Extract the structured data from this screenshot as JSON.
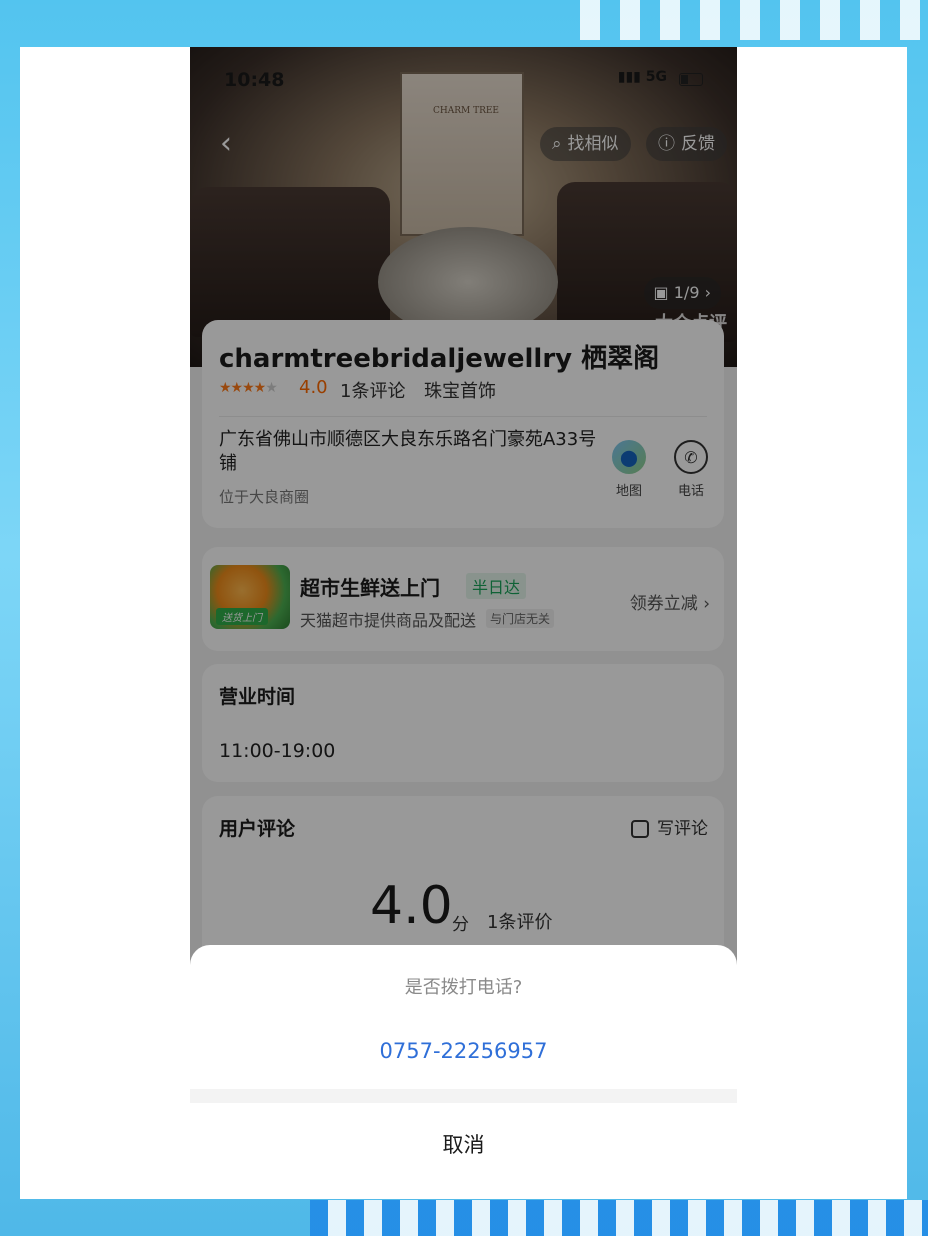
{
  "status_bar": {
    "time": "10:48",
    "network": "5G"
  },
  "hero": {
    "back_icon": "chevron-left-icon",
    "find_similar": "找相似",
    "feedback": "反馈",
    "photo_counter": "1/9",
    "store_sign": "CHARM TREE"
  },
  "store": {
    "name": "charmtreebridaljewellry 栖翠阁",
    "stars": 4,
    "rating": "4.0",
    "review_count": "1条评论",
    "category": "珠宝首饰",
    "address": "广东省佛山市顺德区大良东乐路名门豪苑A33号铺",
    "area": "位于大良商圈",
    "map_label": "地图",
    "phone_label": "电话"
  },
  "promo": {
    "image_tag": "送货上门",
    "title": "超市生鲜送上门",
    "badge": "半日达",
    "subtitle": "天猫超市提供商品及配送",
    "note": "与门店无关",
    "link": "领券立减"
  },
  "hours": {
    "title": "营业时间",
    "value": "11:00-19:00"
  },
  "reviews": {
    "title": "用户评论",
    "write": "写评论",
    "score": "4.0",
    "unit": "分",
    "count": "1条评价"
  },
  "dialog": {
    "question": "是否拨打电话?",
    "number": "0757-22256957",
    "cancel": "取消"
  },
  "colors": {
    "accent_blue": "#2f6fd8",
    "rating_orange": "#ff6a00",
    "badge_green": "#1aa35a"
  }
}
